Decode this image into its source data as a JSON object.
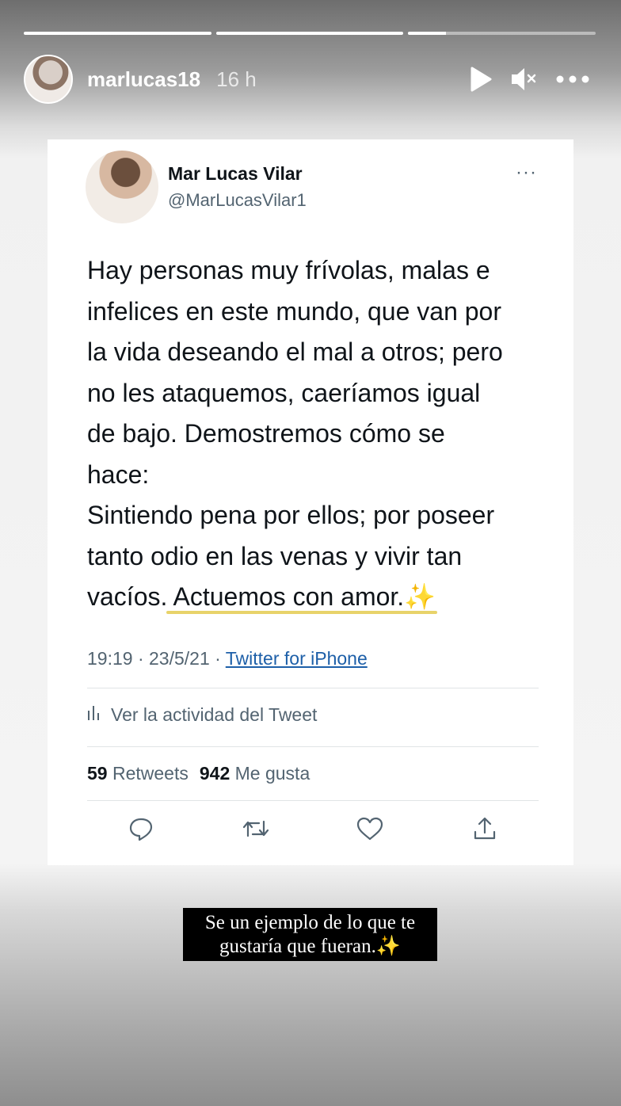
{
  "story": {
    "progress": [
      1.0,
      1.0,
      0.2
    ],
    "username": "marlucas18",
    "time_ago": "16 h"
  },
  "header_icons": [
    "play-icon",
    "mute-icon",
    "more-options-icon"
  ],
  "tweet": {
    "display_name": "Mar Lucas Vilar",
    "handle": "@MarLucasVilar1",
    "more": "···",
    "body": "Hay personas muy frívolas, malas e\ninfelices en este mundo, que van por\nla vida deseando el mal a otros; pero\nno les ataquemos, caeríamos igual\nde bajo. Demostremos cómo se\nhace:\nSintiendo pena por ellos; por poseer\ntanto odio en las venas y vivir tan\nvacíos. Actuemos con amor.",
    "body_emoji": "✨",
    "time": "19:19 · 23/5/21 · ",
    "source": "Twitter for iPhone",
    "activity": "Ver la actividad del Tweet",
    "retweets_count": "59",
    "retweets_label": "Retweets",
    "likes_count": "942",
    "likes_label": "Me gusta",
    "action_icons": [
      "reply-icon",
      "retweet-icon",
      "like-icon",
      "share-icon"
    ]
  },
  "caption": {
    "line1": "Se un ejemplo de lo que te",
    "line2": "gustaría que fueran.",
    "emoji": "✨"
  },
  "colors": {
    "twitter_link": "#1d5fa8",
    "secondary_text": "#536471",
    "caption_bg": "#000000"
  }
}
